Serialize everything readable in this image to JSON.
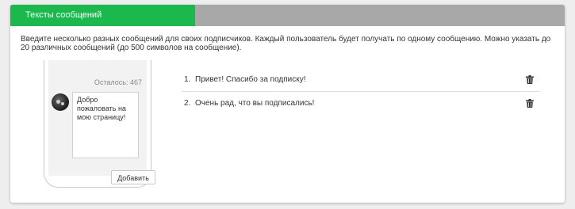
{
  "header": {
    "tab_label": "Тексты сообщений"
  },
  "description": "Введите несколько разных сообщений для своих подписчиков. Каждый пользователь будет получать по одному сообщению. Можно указать до 20 различных сообщений (до 500 символов на сообщение).",
  "phone": {
    "remaining_label": "Осталось: 467",
    "message_value": "Добро пожаловать на мою страницу!",
    "add_button_label": "Добавить"
  },
  "messages": [
    {
      "number": "1.",
      "text": "Привет! Спасибо за подписку!",
      "action_icon": "trash-icon"
    },
    {
      "number": "2.",
      "text": "Очень рад, что вы подписались!",
      "action_icon": "trash-icon"
    }
  ],
  "colors": {
    "accent": "#1bb84e",
    "header_bg": "#a8a8a8"
  }
}
